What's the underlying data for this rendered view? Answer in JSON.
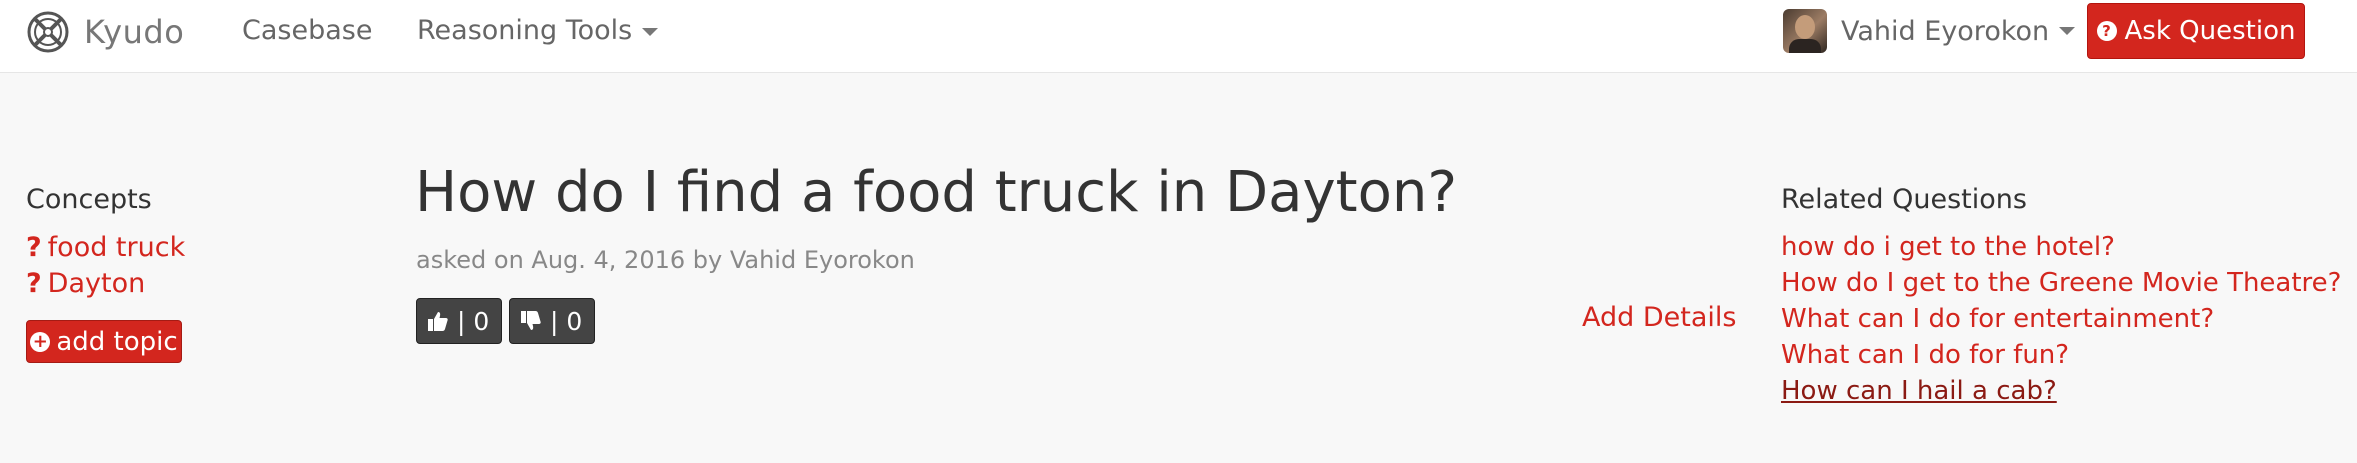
{
  "navbar": {
    "brand": "Kyudo",
    "links": [
      "Casebase",
      "Reasoning Tools"
    ],
    "user_name": "Vahid Eyorokon",
    "ask_button": "Ask Question"
  },
  "concepts": {
    "title": "Concepts",
    "items": [
      "food truck",
      "Dayton"
    ],
    "add_topic": "add topic"
  },
  "question": {
    "title": "How do I find a food truck in Dayton?",
    "meta": "asked on Aug. 4, 2016 by Vahid Eyorokon",
    "upvotes": "| 0",
    "downvotes": "| 0",
    "add_details": "Add Details"
  },
  "related": {
    "title": "Related Questions",
    "items": [
      "how do i get to the hotel?",
      "How do I get to the Greene Movie Theatre?",
      "What can I do for entertainment?",
      "What can I do for fun?",
      "How can I hail a cab?"
    ]
  },
  "colors": {
    "accent": "#d3261e",
    "vote_bg": "#444444",
    "page_bg": "#f8f8f8"
  }
}
